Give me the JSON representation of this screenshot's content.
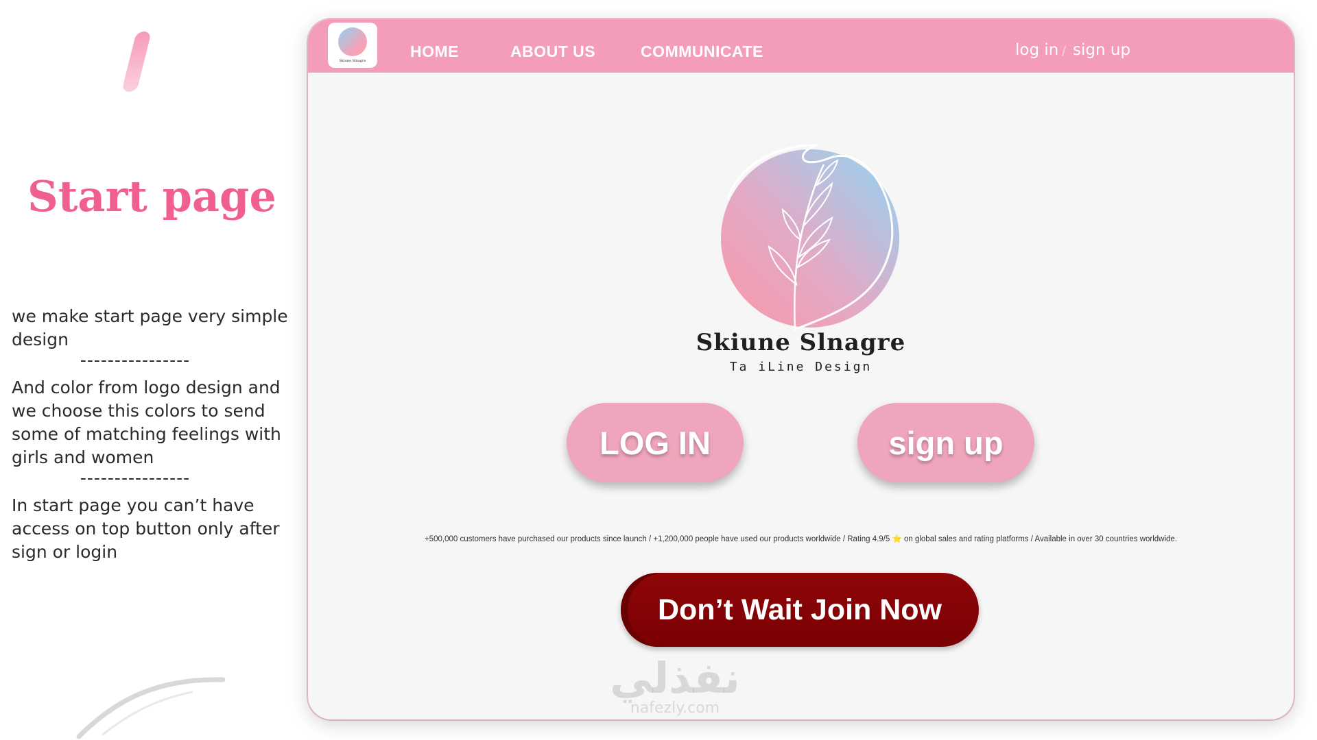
{
  "side": {
    "title": "Start page",
    "para1": "we make start page very simple design",
    "divider1": "----------------",
    "para2": "And color from logo design and we choose this colors to send some of matching feelings with girls and women",
    "divider2": "----------------",
    "para3": "In start page you can’t have access on top button only after sign or login"
  },
  "nav": {
    "logo_text": "Skiune Slnagre",
    "links": [
      "HOME",
      "ABOUT US",
      "COMMUNICATE"
    ],
    "login": "log in",
    "separator": "/",
    "signup": "sign up"
  },
  "brand": {
    "name": "Skiune Slnagre",
    "tagline": "Ta iLine Design"
  },
  "buttons": {
    "login": "LOG IN",
    "signup": "sign up"
  },
  "stats_text": "+500,000 customers have purchased our products since launch  /  +1,200,000 people have used our products worldwide  /  Rating 4.9/5 ⭐ on global sales and rating platforms  /  Available in over 30 countries worldwide.",
  "cta": "Don’t  Wait Join Now",
  "watermark": {
    "arabic": "نفذلي",
    "latin": "nafezly.com"
  },
  "colors": {
    "nav": "#f49db9",
    "title": "#f0608e",
    "pill": "#efa5bb",
    "cta": "#8e0609"
  },
  "icons": [
    "logo-leaf-icon",
    "slash-decoration-icon",
    "curve-decoration-icon"
  ]
}
